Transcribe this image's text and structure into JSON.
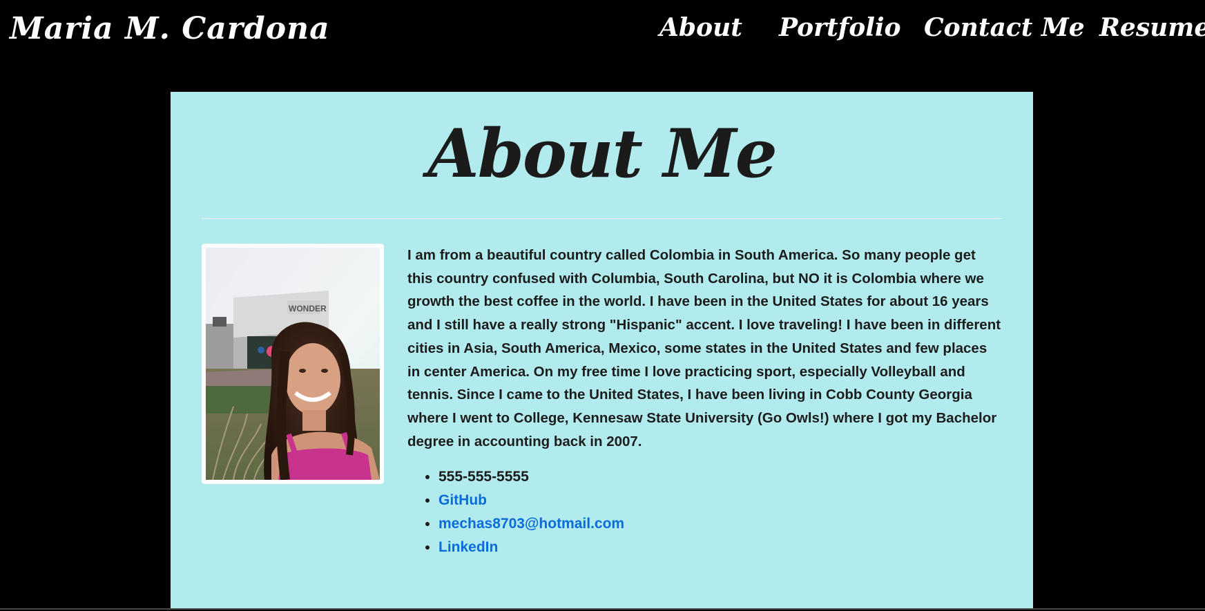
{
  "header": {
    "brand": "Maria M. Cardona",
    "nav": [
      {
        "label": "About"
      },
      {
        "label": "Portfolio"
      },
      {
        "label": "Contact Me"
      },
      {
        "label": "Resume"
      }
    ]
  },
  "main": {
    "title": "About Me",
    "bio": "I am from a beautiful country called Colombia in South America. So many people get this country confused with Columbia, South Carolina, but NO it is Colombia where we growth the best coffee in the world. I have been in the United States for about 16 years and I still have a really strong \"Hispanic\" accent. I love traveling! I have been in different cities in Asia, South America, Mexico, some states in the United States and few places in center America. On my free time I love practicing sport, especially Volleyball and tennis. Since I came to the United States, I have been living in Cobb County Georgia where I went to College, Kennesaw State University (Go Owls!) where I got my Bachelor degree in accounting back in 2007.",
    "contacts": {
      "phone": "555-555-5555",
      "github": "GitHub",
      "email": "mechas8703@hotmail.com",
      "linkedin": "LinkedIn"
    },
    "photo_sign": "WONDER"
  },
  "colors": {
    "page_bg": "#000000",
    "card_bg": "#b2ebed",
    "text": "#1c1c1c",
    "link": "#0a6cd8",
    "nav_text": "#ffffff"
  }
}
